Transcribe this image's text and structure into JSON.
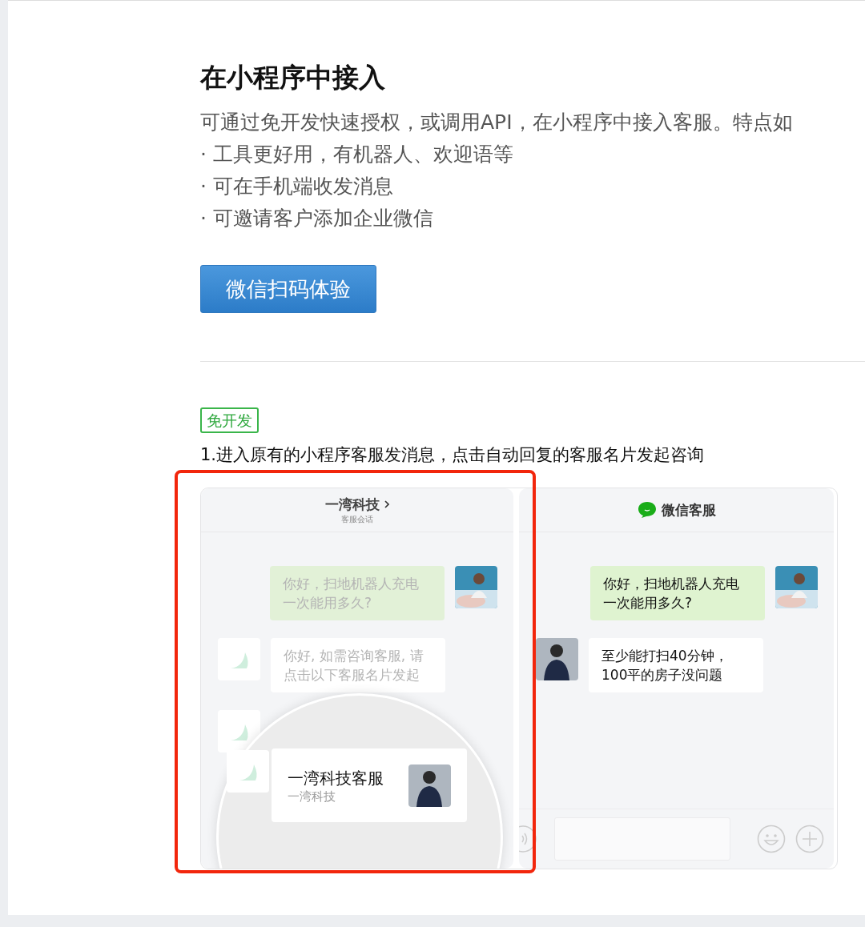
{
  "heading": "在小程序中接入",
  "description": "可通过免开发快速授权，或调用API，在小程序中接入客服。特点如",
  "bullets": [
    "· 工具更好用，有机器人、欢迎语等",
    "· 可在手机端收发消息",
    "· 可邀请客户添加企业微信"
  ],
  "button": "微信扫码体验",
  "tag": "免开发",
  "step_caption": "1.进入原有的小程序客服发消息，点击自动回复的客服名片发起咨询",
  "left_screen": {
    "title": "一湾科技",
    "subtitle": "客服会话",
    "highlighted": true,
    "messages": [
      {
        "kind": "user",
        "text": "你好，扫地机器人充电一次能用多久?"
      },
      {
        "kind": "bot",
        "text": "你好, 如需咨询客服, 请点击以下客服名片发起"
      },
      {
        "kind": "bot_avatar"
      }
    ],
    "card": {
      "name": "一湾科技客服",
      "company": "一湾科技"
    }
  },
  "right_screen": {
    "title": "微信客服",
    "messages": [
      {
        "kind": "user",
        "text": "你好，扫地机器人充电一次能用多久?"
      },
      {
        "kind": "agent",
        "text": "至少能打扫40分钟，100平的房子没问题"
      }
    ]
  }
}
